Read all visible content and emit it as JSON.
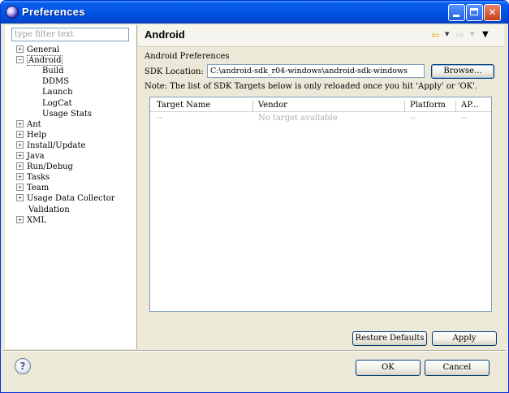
{
  "window": {
    "title": "Preferences",
    "controls": {
      "minimize": "minimize",
      "maximize": "maximize",
      "close": "✕"
    }
  },
  "sidebar": {
    "filter_placeholder": "type filter text",
    "tree": [
      {
        "label": "General",
        "expander": "+",
        "level": 0
      },
      {
        "label": "Android",
        "expander": "−",
        "level": 0,
        "selected": true
      },
      {
        "label": "Build",
        "level": 1
      },
      {
        "label": "DDMS",
        "level": 1
      },
      {
        "label": "Launch",
        "level": 1
      },
      {
        "label": "LogCat",
        "level": 1
      },
      {
        "label": "Usage Stats",
        "level": 1
      },
      {
        "label": "Ant",
        "expander": "+",
        "level": 0
      },
      {
        "label": "Help",
        "expander": "+",
        "level": 0
      },
      {
        "label": "Install/Update",
        "expander": "+",
        "level": 0
      },
      {
        "label": "Java",
        "expander": "+",
        "level": 0
      },
      {
        "label": "Run/Debug",
        "expander": "+",
        "level": 0
      },
      {
        "label": "Tasks",
        "expander": "+",
        "level": 0
      },
      {
        "label": "Team",
        "expander": "+",
        "level": 0
      },
      {
        "label": "Usage Data Collector",
        "expander": "+",
        "level": 0
      },
      {
        "label": "Validation",
        "level": 0
      },
      {
        "label": "XML",
        "expander": "+",
        "level": 0
      }
    ]
  },
  "page": {
    "title": "Android",
    "nav": {
      "back": "⇦",
      "back_drop": "▼",
      "forward": "⇨",
      "forward_drop": "▼",
      "menu": "▼"
    },
    "section_label": "Android Preferences",
    "sdk_location_label": "SDK Location:",
    "sdk_location_value": "C:\\android-sdk_r04-windows\\android-sdk-windows",
    "browse_label": "Browse...",
    "note": "Note: The list of SDK Targets below is only reloaded once you hit 'Apply' or 'OK'.",
    "table": {
      "columns": [
        "Target Name",
        "Vendor",
        "Platform",
        "AP..."
      ],
      "rows": [
        [
          "--",
          "No target available",
          "--",
          "--"
        ]
      ]
    },
    "restore_defaults_label": "Restore Defaults",
    "apply_label": "Apply"
  },
  "footer": {
    "help": "?",
    "ok_label": "OK",
    "cancel_label": "Cancel"
  }
}
